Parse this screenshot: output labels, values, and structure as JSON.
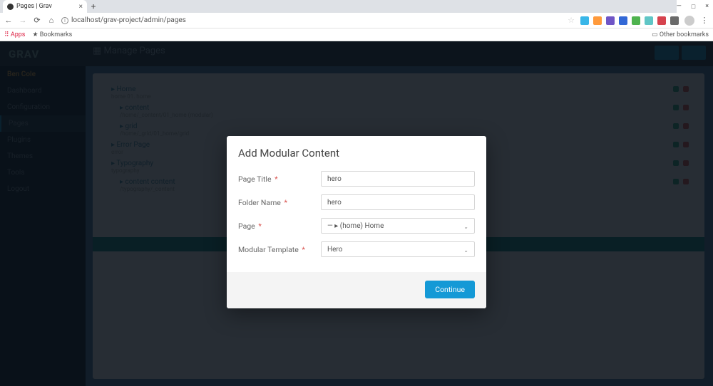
{
  "browser": {
    "tab_title": "Pages | Grav",
    "url": "localhost/grav-project/admin/pages",
    "window_controls": {
      "minimize": "—",
      "maximize": "□",
      "close": "×"
    },
    "bookmarks": {
      "apps": "Apps",
      "bookmarks": "Bookmarks",
      "other": "Other bookmarks"
    },
    "ext_colors": [
      "#39b6e8",
      "#ff9a3c",
      "#6f55c6",
      "#3368d6",
      "#4fb34f",
      "#60c6c6",
      "#d6434e",
      "#6a6a6a"
    ]
  },
  "app": {
    "logo": "GRAV",
    "page_header": "Manage Pages",
    "sidebar": {
      "user": "Ben Cole",
      "items": [
        "Dashboard",
        "Configuration",
        "Pages",
        "Plugins",
        "Themes",
        "Tools",
        "Logout"
      ]
    },
    "tree": {
      "items": [
        {
          "label": "Home",
          "sub": "home 01. home"
        },
        {
          "label": "content",
          "sub": "/home/_content/01_home (modular)",
          "indent": 1
        },
        {
          "label": "grid",
          "sub": "/home/_grid/01_home/grid",
          "indent": 1
        },
        {
          "label": "Error Page",
          "sub": "error"
        },
        {
          "label": "Typography",
          "sub": "typography"
        },
        {
          "label": "content content",
          "sub": "/typography/_content",
          "indent": 1
        }
      ]
    }
  },
  "modal": {
    "title": "Add Modular Content",
    "fields": {
      "page_title": {
        "label": "Page Title",
        "value": "hero",
        "required": true
      },
      "folder_name": {
        "label": "Folder Name",
        "value": "hero",
        "required": true
      },
      "page": {
        "label": "Page",
        "value": "—  ▸  (home) Home",
        "required": true,
        "type": "select"
      },
      "modular_template": {
        "label": "Modular Template",
        "value": "Hero",
        "required": true,
        "type": "select"
      }
    },
    "continue": "Continue"
  }
}
